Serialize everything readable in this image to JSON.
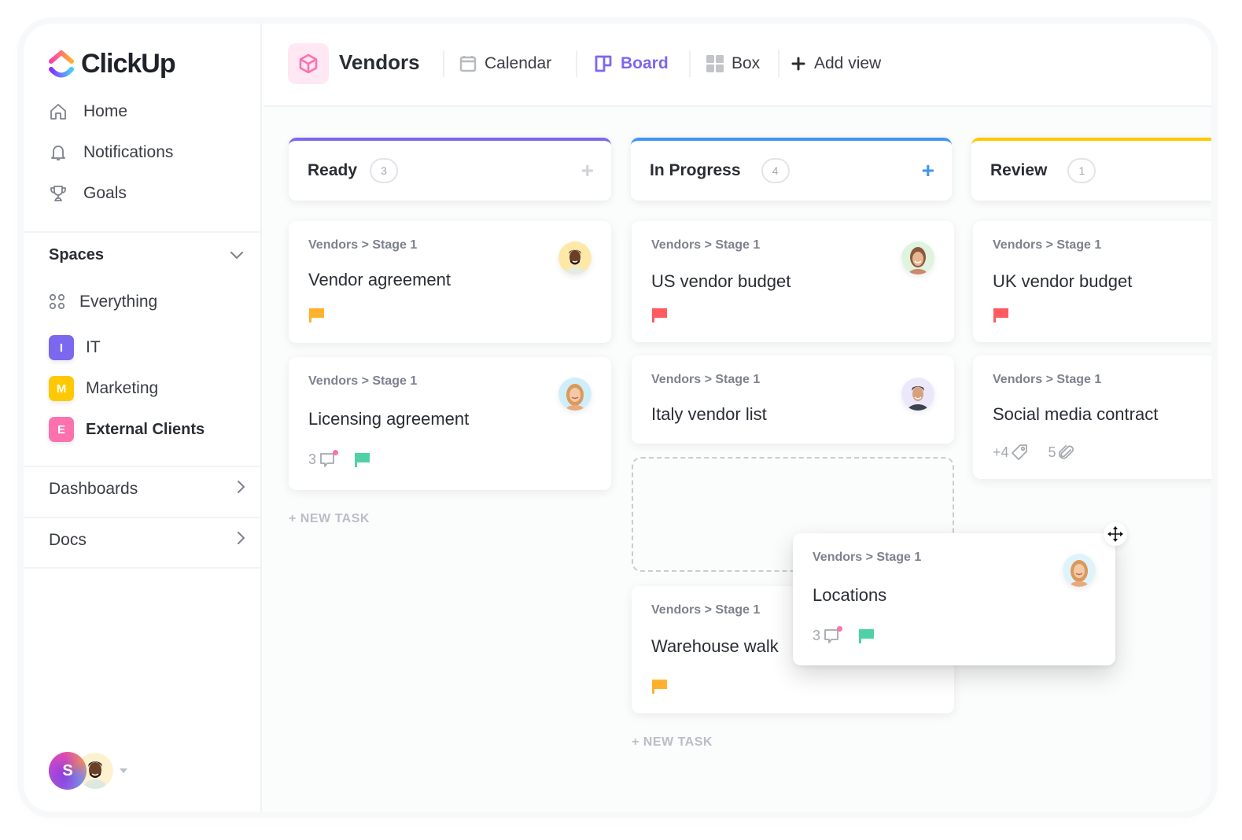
{
  "app": {
    "name": "ClickUp",
    "brand_colors": [
      "#fd71af",
      "#ff9a3c",
      "#7b68ee",
      "#49ccf9"
    ]
  },
  "sidebar": {
    "nav": [
      {
        "label": "Home",
        "icon": "home-icon"
      },
      {
        "label": "Notifications",
        "icon": "bell-icon"
      },
      {
        "label": "Goals",
        "icon": "trophy-icon"
      }
    ],
    "spaces_title": "Spaces",
    "spaces": [
      {
        "label": "Everything",
        "icon": "grid-dots-icon"
      },
      {
        "label": "IT",
        "badge": "I",
        "color": "#7b68ee"
      },
      {
        "label": "Marketing",
        "badge": "M",
        "color": "#ffc800"
      },
      {
        "label": "External Clients",
        "badge": "E",
        "color": "#fd71af",
        "active": true
      }
    ],
    "sections": [
      {
        "label": "Dashboards"
      },
      {
        "label": "Docs"
      }
    ],
    "user_initial": "S"
  },
  "header": {
    "list_title": "Vendors",
    "views": [
      {
        "label": "Calendar",
        "icon": "calendar-icon"
      },
      {
        "label": "Board",
        "icon": "board-icon",
        "active": true
      },
      {
        "label": "Box",
        "icon": "box-grid-icon"
      },
      {
        "label": "Add view",
        "icon": "plus-icon"
      }
    ]
  },
  "board": {
    "breadcrumb": "Vendors > Stage 1",
    "new_task_label": "+ NEW TASK",
    "columns": [
      {
        "name": "Ready",
        "count": "3",
        "color": "#7b68ee",
        "cards": [
          {
            "title": "Vendor agreement",
            "flag": "#ffb12e"
          },
          {
            "title": "Licensing agreement",
            "comments": "3",
            "flag": "#4fd1a5"
          }
        ]
      },
      {
        "name": "In Progress",
        "count": "4",
        "color": "#4194f6",
        "cards": [
          {
            "title": "US vendor budget",
            "flag": "#ff5a5f"
          },
          {
            "title": "Italy vendor list"
          },
          {
            "title": "Warehouse walk",
            "flag": "#ffb12e"
          }
        ]
      },
      {
        "name": "Review",
        "count": "1",
        "color": "#ffc800",
        "cards": [
          {
            "title": "UK vendor budget",
            "flag": "#ff5a5f"
          },
          {
            "title": "Social media contract",
            "tags": "+4",
            "attachments": "5"
          }
        ]
      }
    ],
    "dragging_card": {
      "title": "Locations",
      "comments": "3",
      "flag": "#4fd1a5"
    }
  }
}
